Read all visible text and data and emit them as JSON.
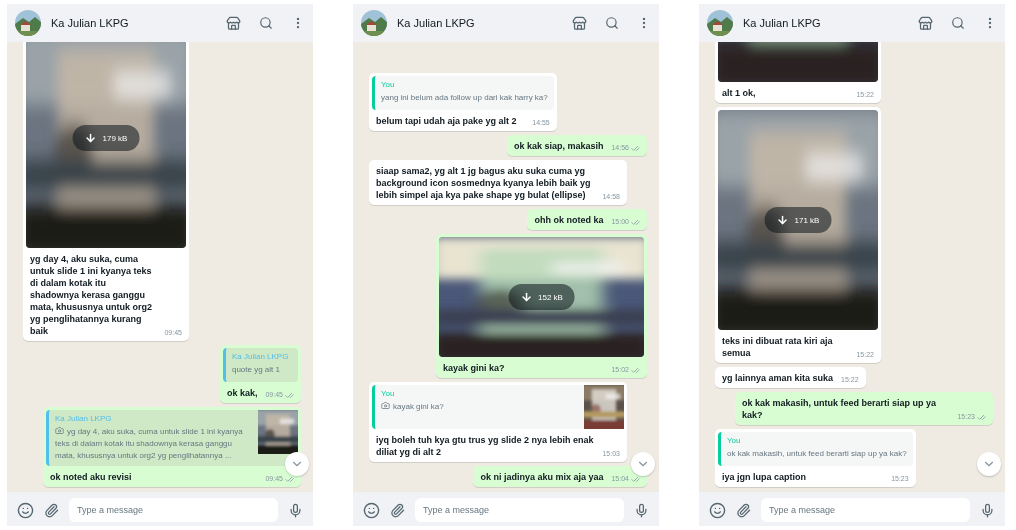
{
  "panels": [
    {
      "contact": {
        "name": "Ka Julian LKPG"
      },
      "messages": [
        {
          "outgoing": false,
          "landscape": false,
          "download_size": "179 kB",
          "text": "yg day 4, aku suka, cuma untuk slide 1 ini kyanya teks di dalam kotak itu shadownya kerasa ganggu mata, khususnya untuk org2 yg penglihatannya kurang baik",
          "time": "09:45"
        },
        {
          "kind": "text",
          "outgoing": true,
          "quote": {
            "author": "Ka Julian LKPG",
            "color": "#53bdeb",
            "photo": false,
            "text": "quote yg alt 1"
          },
          "text": "ok kak,",
          "time": "09:45"
        },
        {
          "kind": "text",
          "outgoing": true,
          "quote": {
            "author": "Ka Julian LKPG",
            "color": "#53bdeb",
            "photo": true,
            "text": "yg day 4, aku suka, cuma untuk slide 1 ini kyanya teks di dalam kotak itu shadownya kerasa ganggu mata, khususnya untuk org2 yg penglihatannya ..."
          },
          "text": "ok noted aku revisi",
          "time": "09:45"
        }
      ],
      "composer": {
        "placeholder": "Type a message"
      }
    },
    {
      "contact": {
        "name": "Ka Julian LKPG"
      },
      "messages": [
        {
          "kind": "text",
          "outgoing": false,
          "quote": {
            "author": "You",
            "color": "#06cf9c",
            "photo": false,
            "text": "yang ini belum ada follow up dari kak harry ka?"
          },
          "text": "belum tapi udah aja pake yg alt 2",
          "time": "14:55"
        },
        {
          "kind": "text",
          "outgoing": true,
          "text": "ok kak siap, makasih",
          "time": "14:56"
        },
        {
          "kind": "text",
          "outgoing": false,
          "text": "siaap sama2, yg alt 1 jg bagus aku suka cuma yg background icon sosmednya kyanya lebih baik yg lebih simpel aja kya pake shape yg bulat (ellipse)",
          "time": "14:58"
        },
        {
          "kind": "text",
          "outgoing": true,
          "text": "ohh ok noted ka",
          "time": "15:00"
        },
        {
          "outgoing": true,
          "landscape": true,
          "download_size": "152 kB",
          "text": "kayak gini ka?",
          "time": "15:02"
        },
        {
          "kind": "text",
          "outgoing": false,
          "quote": {
            "author": "You",
            "color": "#06cf9c",
            "photo": true,
            "text": "kayak gini ka?"
          },
          "text": "iyq boleh tuh kya gtu trus yg slide 2 nya lebih enak diliat yg di alt 2",
          "time": "15:03"
        },
        {
          "kind": "text",
          "outgoing": true,
          "text": "ok ni jadinya aku mix aja yaa",
          "time": "15:04"
        }
      ],
      "composer": {
        "placeholder": "Type a message"
      }
    },
    {
      "contact": {
        "name": "Ka Julian LKPG"
      },
      "messages": [
        {
          "outgoing": false,
          "landscape": false,
          "text": "alt 1 ok,",
          "time": "15:22"
        },
        {
          "outgoing": false,
          "landscape": false,
          "download_size": "171 kB",
          "text": "teks ini dibuat rata kiri aja semua",
          "time": "15:22"
        },
        {
          "kind": "text",
          "outgoing": false,
          "text": "yg lainnya aman kita suka",
          "time": "15:22"
        },
        {
          "kind": "text",
          "outgoing": true,
          "text": "ok kak makasih, untuk feed berarti siap up ya kak?",
          "time": "15:23"
        },
        {
          "kind": "text",
          "outgoing": false,
          "quote": {
            "author": "You",
            "color": "#06cf9c",
            "photo": false,
            "text": "ok kak makasih, untuk feed berarti siap up ya kak?"
          },
          "text": "iya jgn lupa caption",
          "time": "15:23"
        }
      ],
      "composer": {
        "placeholder": "Type a message"
      }
    }
  ]
}
